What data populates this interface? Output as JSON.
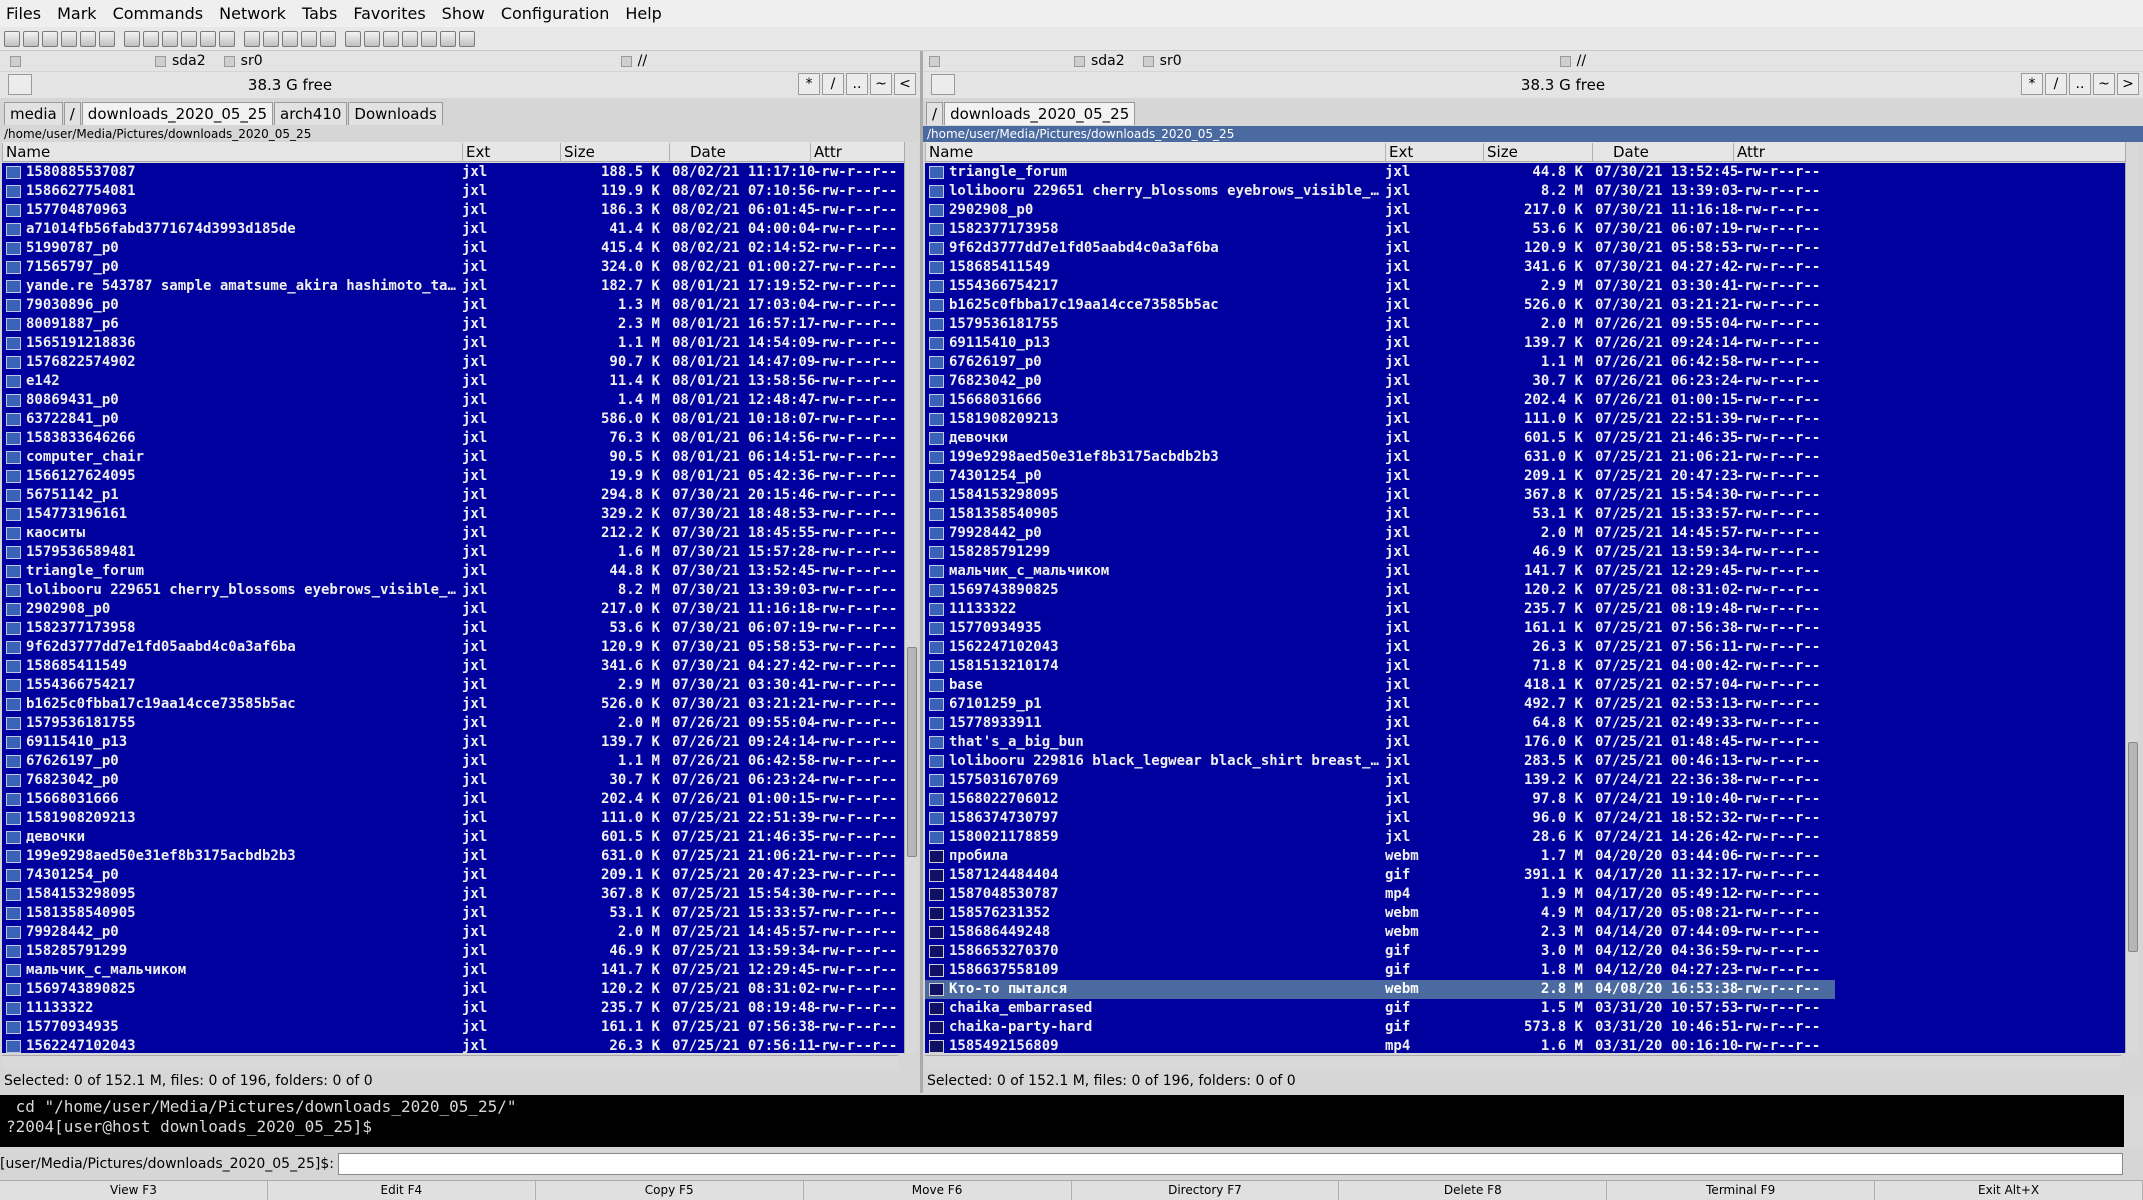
{
  "menu": [
    "Files",
    "Mark",
    "Commands",
    "Network",
    "Tabs",
    "Favorites",
    "Show",
    "Configuration",
    "Help"
  ],
  "left": {
    "drives": [
      "sda2",
      "sr0"
    ],
    "root": "//",
    "free": "38.3 G free",
    "nav_buttons": [
      "*",
      "/",
      "..",
      "~",
      "<"
    ],
    "tabs": [
      "media",
      "/",
      "downloads_2020_05_25",
      "arch410",
      "Downloads"
    ],
    "active_tab": 2,
    "path": "/home/user/Media/Pictures/downloads_2020_05_25",
    "columns": [
      "Name",
      "Ext",
      "Size",
      "Date",
      "Attr"
    ],
    "status": "Selected: 0 of 152.1 M, files: 0 of 196, folders: 0 of 0",
    "files": [
      [
        "1580885537087",
        "jxl",
        "188.5 K",
        "08/02/21 11:17:10",
        "-rw-r--r--"
      ],
      [
        "1586627754081",
        "jxl",
        "119.9 K",
        "08/02/21 07:10:56",
        "-rw-r--r--"
      ],
      [
        "157704870963",
        "jxl",
        "186.3 K",
        "08/02/21 06:01:45",
        "-rw-r--r--"
      ],
      [
        "a71014fb56fabd3771674d3993d185de",
        "jxl",
        "41.4 K",
        "08/02/21 04:00:04",
        "-rw-r--r--"
      ],
      [
        "51990787_p0",
        "jxl",
        "415.4 K",
        "08/02/21 02:14:52",
        "-rw-r--r--"
      ],
      [
        "71565797_p0",
        "jxl",
        "324.0 K",
        "08/02/21 01:00:27",
        "-rw-r--r--"
      ],
      [
        "yande.re 543787 sample amatsume_akira hashimoto_tak…",
        "jxl",
        "182.7 K",
        "08/01/21 17:19:52",
        "-rw-r--r--"
      ],
      [
        "79030896_p0",
        "jxl",
        "1.3 M",
        "08/01/21 17:03:04",
        "-rw-r--r--"
      ],
      [
        "80091887_p6",
        "jxl",
        "2.3 M",
        "08/01/21 16:57:17",
        "-rw-r--r--"
      ],
      [
        "1565191218836",
        "jxl",
        "1.1 M",
        "08/01/21 14:54:09",
        "-rw-r--r--"
      ],
      [
        "1576822574902",
        "jxl",
        "90.7 K",
        "08/01/21 14:47:09",
        "-rw-r--r--"
      ],
      [
        "e142",
        "jxl",
        "11.4 K",
        "08/01/21 13:58:56",
        "-rw-r--r--"
      ],
      [
        "80869431_p0",
        "jxl",
        "1.4 M",
        "08/01/21 12:48:47",
        "-rw-r--r--"
      ],
      [
        "63722841_p0",
        "jxl",
        "586.0 K",
        "08/01/21 10:18:07",
        "-rw-r--r--"
      ],
      [
        "1583833646266",
        "jxl",
        "76.3 K",
        "08/01/21 06:14:56",
        "-rw-r--r--"
      ],
      [
        "computer_chair",
        "jxl",
        "90.5 K",
        "08/01/21 06:14:51",
        "-rw-r--r--"
      ],
      [
        "1566127624095",
        "jxl",
        "19.9 K",
        "08/01/21 05:42:36",
        "-rw-r--r--"
      ],
      [
        "56751142_p1",
        "jxl",
        "294.8 K",
        "07/30/21 20:15:46",
        "-rw-r--r--"
      ],
      [
        "154773196161",
        "jxl",
        "329.2 K",
        "07/30/21 18:48:53",
        "-rw-r--r--"
      ],
      [
        "каоситы",
        "jxl",
        "212.2 K",
        "07/30/21 18:45:55",
        "-rw-r--r--"
      ],
      [
        "1579536589481",
        "jxl",
        "1.6 M",
        "07/30/21 15:57:28",
        "-rw-r--r--"
      ],
      [
        "triangle_forum",
        "jxl",
        "44.8 K",
        "07/30/21 13:52:45",
        "-rw-r--r--"
      ],
      [
        "lolibooru 229651 cherry_blossoms eyebrows_visible_throu…",
        "jxl",
        "8.2 M",
        "07/30/21 13:39:03",
        "-rw-r--r--"
      ],
      [
        "2902908_p0",
        "jxl",
        "217.0 K",
        "07/30/21 11:16:18",
        "-rw-r--r--"
      ],
      [
        "1582377173958",
        "jxl",
        "53.6 K",
        "07/30/21 06:07:19",
        "-rw-r--r--"
      ],
      [
        "9f62d3777dd7e1fd05aabd4c0a3af6ba",
        "jxl",
        "120.9 K",
        "07/30/21 05:58:53",
        "-rw-r--r--"
      ],
      [
        "158685411549",
        "jxl",
        "341.6 K",
        "07/30/21 04:27:42",
        "-rw-r--r--"
      ],
      [
        "1554366754217",
        "jxl",
        "2.9 M",
        "07/30/21 03:30:41",
        "-rw-r--r--"
      ],
      [
        "b1625c0fbba17c19aa14cce73585b5ac",
        "jxl",
        "526.0 K",
        "07/30/21 03:21:21",
        "-rw-r--r--"
      ],
      [
        "1579536181755",
        "jxl",
        "2.0 M",
        "07/26/21 09:55:04",
        "-rw-r--r--"
      ],
      [
        "69115410_p13",
        "jxl",
        "139.7 K",
        "07/26/21 09:24:14",
        "-rw-r--r--"
      ],
      [
        "67626197_p0",
        "jxl",
        "1.1 M",
        "07/26/21 06:42:58",
        "-rw-r--r--"
      ],
      [
        "76823042_p0",
        "jxl",
        "30.7 K",
        "07/26/21 06:23:24",
        "-rw-r--r--"
      ],
      [
        "15668031666",
        "jxl",
        "202.4 K",
        "07/26/21 01:00:15",
        "-rw-r--r--"
      ],
      [
        "1581908209213",
        "jxl",
        "111.0 K",
        "07/25/21 22:51:39",
        "-rw-r--r--"
      ],
      [
        "девочки",
        "jxl",
        "601.5 K",
        "07/25/21 21:46:35",
        "-rw-r--r--"
      ],
      [
        "199e9298aed50e31ef8b3175acbdb2b3",
        "jxl",
        "631.0 K",
        "07/25/21 21:06:21",
        "-rw-r--r--"
      ],
      [
        "74301254_p0",
        "jxl",
        "209.1 K",
        "07/25/21 20:47:23",
        "-rw-r--r--"
      ],
      [
        "1584153298095",
        "jxl",
        "367.8 K",
        "07/25/21 15:54:30",
        "-rw-r--r--"
      ],
      [
        "1581358540905",
        "jxl",
        "53.1 K",
        "07/25/21 15:33:57",
        "-rw-r--r--"
      ],
      [
        "79928442_p0",
        "jxl",
        "2.0 M",
        "07/25/21 14:45:57",
        "-rw-r--r--"
      ],
      [
        "158285791299",
        "jxl",
        "46.9 K",
        "07/25/21 13:59:34",
        "-rw-r--r--"
      ],
      [
        "мальчик_с_мальчиком",
        "jxl",
        "141.7 K",
        "07/25/21 12:29:45",
        "-rw-r--r--"
      ],
      [
        "1569743890825",
        "jxl",
        "120.2 K",
        "07/25/21 08:31:02",
        "-rw-r--r--"
      ],
      [
        "11133322",
        "jxl",
        "235.7 K",
        "07/25/21 08:19:48",
        "-rw-r--r--"
      ],
      [
        "15770934935",
        "jxl",
        "161.1 K",
        "07/25/21 07:56:38",
        "-rw-r--r--"
      ],
      [
        "1562247102043",
        "jxl",
        "26.3 K",
        "07/25/21 07:56:11",
        "-rw-r--r--"
      ]
    ]
  },
  "right": {
    "drives": [
      "sda2",
      "sr0"
    ],
    "root": "//",
    "free": "38.3 G free",
    "nav_buttons": [
      "*",
      "/",
      "..",
      "~",
      ">"
    ],
    "tabs": [
      "/",
      "downloads_2020_05_25"
    ],
    "active_tab": 1,
    "path": "/home/user/Media/Pictures/downloads_2020_05_25",
    "columns": [
      "Name",
      "Ext",
      "Size",
      "Date",
      "Attr"
    ],
    "status": "Selected: 0 of 152.1 M, files: 0 of 196, folders: 0 of 0",
    "selected_row": 43,
    "files": [
      [
        "triangle_forum",
        "jxl",
        "44.8 K",
        "07/30/21 13:52:45",
        "-rw-r--r--"
      ],
      [
        "lolibooru 229651 cherry_blossoms eyebrows_visible_throu…",
        "jxl",
        "8.2 M",
        "07/30/21 13:39:03",
        "-rw-r--r--"
      ],
      [
        "2902908_p0",
        "jxl",
        "217.0 K",
        "07/30/21 11:16:18",
        "-rw-r--r--"
      ],
      [
        "1582377173958",
        "jxl",
        "53.6 K",
        "07/30/21 06:07:19",
        "-rw-r--r--"
      ],
      [
        "9f62d3777dd7e1fd05aabd4c0a3af6ba",
        "jxl",
        "120.9 K",
        "07/30/21 05:58:53",
        "-rw-r--r--"
      ],
      [
        "158685411549",
        "jxl",
        "341.6 K",
        "07/30/21 04:27:42",
        "-rw-r--r--"
      ],
      [
        "1554366754217",
        "jxl",
        "2.9 M",
        "07/30/21 03:30:41",
        "-rw-r--r--"
      ],
      [
        "b1625c0fbba17c19aa14cce73585b5ac",
        "jxl",
        "526.0 K",
        "07/30/21 03:21:21",
        "-rw-r--r--"
      ],
      [
        "1579536181755",
        "jxl",
        "2.0 M",
        "07/26/21 09:55:04",
        "-rw-r--r--"
      ],
      [
        "69115410_p13",
        "jxl",
        "139.7 K",
        "07/26/21 09:24:14",
        "-rw-r--r--"
      ],
      [
        "67626197_p0",
        "jxl",
        "1.1 M",
        "07/26/21 06:42:58",
        "-rw-r--r--"
      ],
      [
        "76823042_p0",
        "jxl",
        "30.7 K",
        "07/26/21 06:23:24",
        "-rw-r--r--"
      ],
      [
        "15668031666",
        "jxl",
        "202.4 K",
        "07/26/21 01:00:15",
        "-rw-r--r--"
      ],
      [
        "1581908209213",
        "jxl",
        "111.0 K",
        "07/25/21 22:51:39",
        "-rw-r--r--"
      ],
      [
        "девочки",
        "jxl",
        "601.5 K",
        "07/25/21 21:46:35",
        "-rw-r--r--"
      ],
      [
        "199e9298aed50e31ef8b3175acbdb2b3",
        "jxl",
        "631.0 K",
        "07/25/21 21:06:21",
        "-rw-r--r--"
      ],
      [
        "74301254_p0",
        "jxl",
        "209.1 K",
        "07/25/21 20:47:23",
        "-rw-r--r--"
      ],
      [
        "1584153298095",
        "jxl",
        "367.8 K",
        "07/25/21 15:54:30",
        "-rw-r--r--"
      ],
      [
        "1581358540905",
        "jxl",
        "53.1 K",
        "07/25/21 15:33:57",
        "-rw-r--r--"
      ],
      [
        "79928442_p0",
        "jxl",
        "2.0 M",
        "07/25/21 14:45:57",
        "-rw-r--r--"
      ],
      [
        "158285791299",
        "jxl",
        "46.9 K",
        "07/25/21 13:59:34",
        "-rw-r--r--"
      ],
      [
        "мальчик_с_мальчиком",
        "jxl",
        "141.7 K",
        "07/25/21 12:29:45",
        "-rw-r--r--"
      ],
      [
        "1569743890825",
        "jxl",
        "120.2 K",
        "07/25/21 08:31:02",
        "-rw-r--r--"
      ],
      [
        "11133322",
        "jxl",
        "235.7 K",
        "07/25/21 08:19:48",
        "-rw-r--r--"
      ],
      [
        "15770934935",
        "jxl",
        "161.1 K",
        "07/25/21 07:56:38",
        "-rw-r--r--"
      ],
      [
        "1562247102043",
        "jxl",
        "26.3 K",
        "07/25/21 07:56:11",
        "-rw-r--r--"
      ],
      [
        "1581513210174",
        "jxl",
        "71.8 K",
        "07/25/21 04:00:42",
        "-rw-r--r--"
      ],
      [
        "base",
        "jxl",
        "418.1 K",
        "07/25/21 02:57:04",
        "-rw-r--r--"
      ],
      [
        "67101259_p1",
        "jxl",
        "492.7 K",
        "07/25/21 02:53:13",
        "-rw-r--r--"
      ],
      [
        "15778933911",
        "jxl",
        "64.8 K",
        "07/25/21 02:49:33",
        "-rw-r--r--"
      ],
      [
        "that's_a_big_bun",
        "jxl",
        "176.0 K",
        "07/25/21 01:48:45",
        "-rw-r--r--"
      ],
      [
        "lolibooru 229816 black_legwear black_shirt breast_pocket…",
        "jxl",
        "283.5 K",
        "07/25/21 00:46:13",
        "-rw-r--r--"
      ],
      [
        "1575031670769",
        "jxl",
        "139.2 K",
        "07/24/21 22:36:38",
        "-rw-r--r--"
      ],
      [
        "1568022706012",
        "jxl",
        "97.8 K",
        "07/24/21 19:10:40",
        "-rw-r--r--"
      ],
      [
        "1586374730797",
        "jxl",
        "96.0 K",
        "07/24/21 18:52:32",
        "-rw-r--r--"
      ],
      [
        "1580021178859",
        "jxl",
        "28.6 K",
        "07/24/21 14:26:42",
        "-rw-r--r--"
      ],
      [
        "пробила",
        "webm",
        "1.7 M",
        "04/20/20 03:44:06",
        "-rw-r--r--"
      ],
      [
        "1587124484404",
        "gif",
        "391.1 K",
        "04/17/20 11:32:17",
        "-rw-r--r--"
      ],
      [
        "1587048530787",
        "mp4",
        "1.9 M",
        "04/17/20 05:49:12",
        "-rw-r--r--"
      ],
      [
        "158576231352",
        "webm",
        "4.9 M",
        "04/17/20 05:08:21",
        "-rw-r--r--"
      ],
      [
        "158686449248",
        "webm",
        "2.3 M",
        "04/14/20 07:44:09",
        "-rw-r--r--"
      ],
      [
        "1586653270370",
        "gif",
        "3.0 M",
        "04/12/20 04:36:59",
        "-rw-r--r--"
      ],
      [
        "1586637558109",
        "gif",
        "1.8 M",
        "04/12/20 04:27:23",
        "-rw-r--r--"
      ],
      [
        "Кто-то пытался",
        "webm",
        "2.8 M",
        "04/08/20 16:53:38",
        "-rw-r--r--"
      ],
      [
        "chaika_embarrased",
        "gif",
        "1.5 M",
        "03/31/20 10:57:53",
        "-rw-r--r--"
      ],
      [
        "chaika-party-hard",
        "gif",
        "573.8 K",
        "03/31/20 10:46:51",
        "-rw-r--r--"
      ],
      [
        "1585492156809",
        "mp4",
        "1.6 M",
        "03/31/20 00:16:10",
        "-rw-r--r--"
      ]
    ]
  },
  "terminal": {
    "line1": " cd \"/home/user/Media/Pictures/downloads_2020_05_25/\"",
    "line2": "?2004[user@host downloads_2020_05_25]$ "
  },
  "cmdline": {
    "prompt": "[user/Media/Pictures/downloads_2020_05_25]$:"
  },
  "fkeys": [
    "View F3",
    "Edit F4",
    "Copy F5",
    "Move F6",
    "Directory F7",
    "Delete F8",
    "Terminal F9",
    "Exit Alt+X"
  ]
}
